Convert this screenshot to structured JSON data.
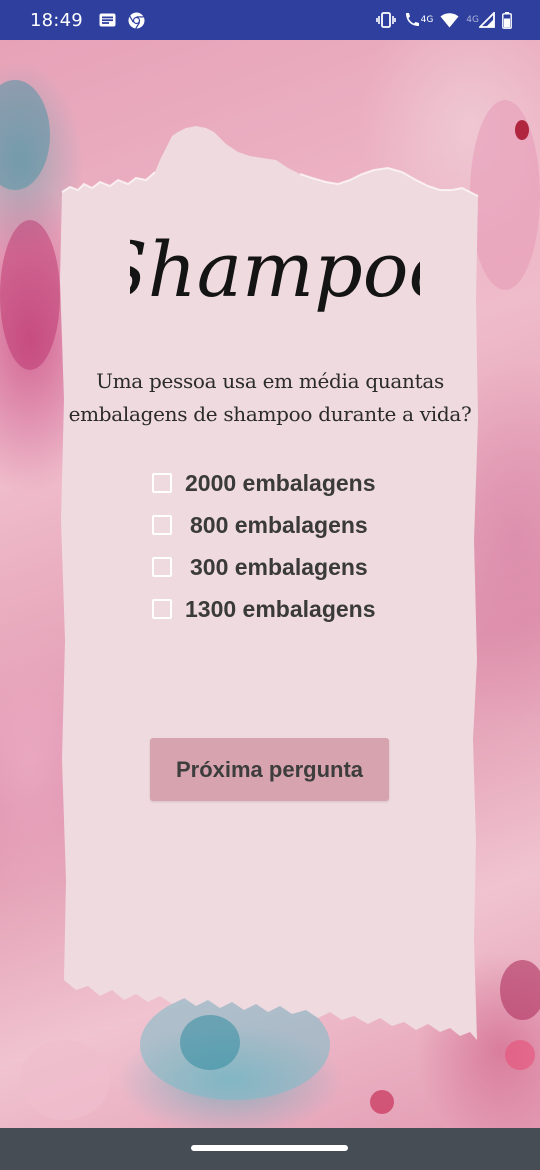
{
  "status_bar": {
    "time": "18:49",
    "left_icons": [
      "news-icon",
      "chrome-icon"
    ],
    "right_icons": [
      "vibrate-icon",
      "volte-call-icon",
      "wifi-icon",
      "signal-4g-icon",
      "battery-icon"
    ],
    "network_label_1": "4G",
    "network_label_2": "4G"
  },
  "app": {
    "logo_text": "Shampoo",
    "question_line_1": "Uma pessoa usa em média quantas",
    "question_line_2": "embalagens de shampoo durante a vida?",
    "options": [
      {
        "label": "2000 embalagens",
        "checked": false
      },
      {
        "label": "800 embalagens",
        "checked": false
      },
      {
        "label": "300 embalagens",
        "checked": false
      },
      {
        "label": "1300 embalagens",
        "checked": false
      }
    ],
    "next_button": "Próxima pergunta"
  },
  "colors": {
    "status_bar": "#2e3f9e",
    "card": "#efdadf",
    "button": "#d7a3ae",
    "nav_bar": "#464d55"
  }
}
